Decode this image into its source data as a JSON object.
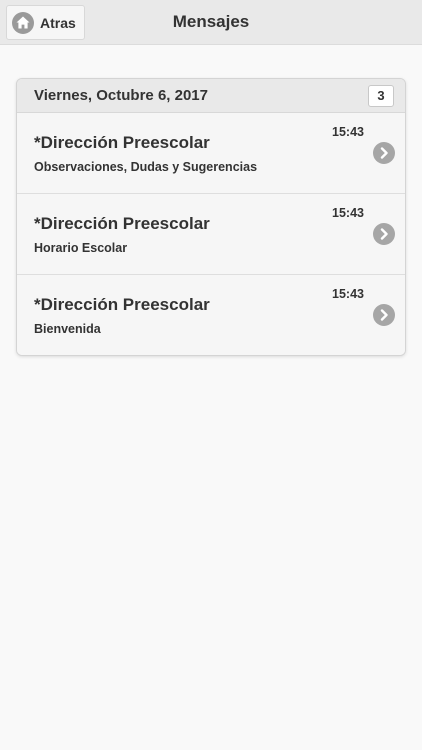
{
  "header": {
    "back_label": "Atras",
    "back_icon": "home-icon",
    "title": "Mensajes"
  },
  "list": {
    "date_divider": "Viernes, Octubre 6, 2017",
    "count": "3",
    "items": [
      {
        "title": "*Dirección Preescolar",
        "subtitle": "Observaciones, Dudas y Sugerencias",
        "time": "15:43",
        "icon": "chevron-right-icon"
      },
      {
        "title": "*Dirección Preescolar",
        "subtitle": "Horario Escolar",
        "time": "15:43",
        "icon": "chevron-right-icon"
      },
      {
        "title": "*Dirección Preescolar",
        "subtitle": "Bienvenida",
        "time": "15:43",
        "icon": "chevron-right-icon"
      }
    ]
  },
  "colors": {
    "header_bg": "#e9e9e9",
    "page_bg": "#f9f9f9",
    "icon_gray": "#a6a6a6",
    "text": "#333333"
  }
}
